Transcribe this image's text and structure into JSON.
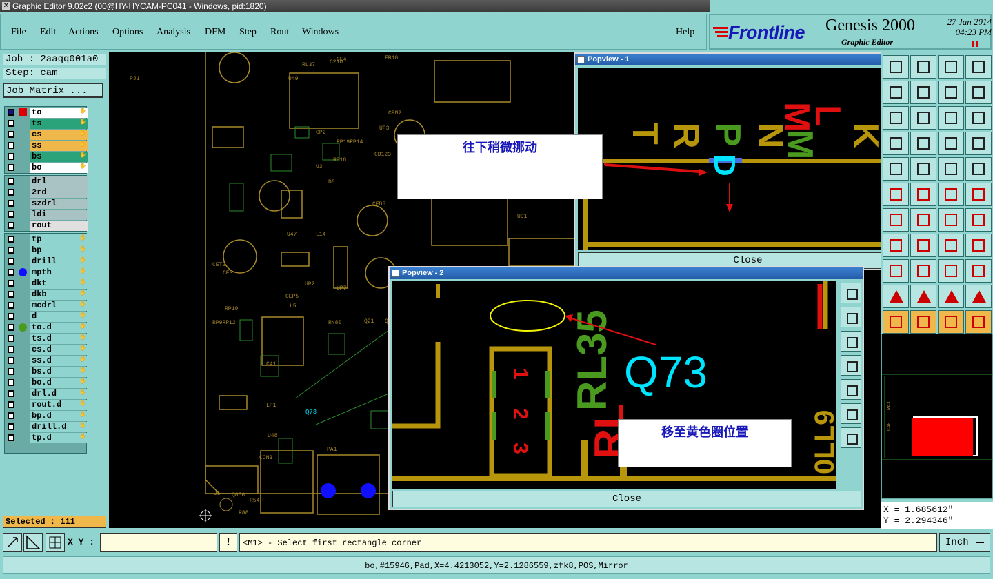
{
  "window": {
    "title": "Graphic Editor 9.02c2 (00@HY-HYCAM-PC041 - Windows, pid:1820)"
  },
  "menu": {
    "items": [
      "File",
      "Edit",
      "Actions",
      "Options",
      "Analysis",
      "DFM",
      "Step",
      "Rout",
      "Windows"
    ],
    "help": "Help"
  },
  "brand": {
    "logo": "Frontline",
    "product": "Genesis 2000",
    "subtitle": "Graphic Editor",
    "date": "27 Jan 2014",
    "time": "04:23 PM"
  },
  "job": {
    "job_label": "Job : 2aaqq001a0",
    "step_label": "Step: cam",
    "matrix_button": "Job Matrix ..."
  },
  "layers": {
    "group1": [
      {
        "name": "to",
        "color": "#ffffff"
      },
      {
        "name": "ts",
        "color": "#2aa37a"
      },
      {
        "name": "cs",
        "color": "#f0b84a"
      },
      {
        "name": "ss",
        "color": "#f0b84a"
      },
      {
        "name": "bs",
        "color": "#2aa37a"
      },
      {
        "name": "bo",
        "color": "#ffffff"
      }
    ],
    "group2": [
      {
        "name": "drl",
        "color": "#a9c2c4"
      },
      {
        "name": "2rd",
        "color": "#a9c2c4"
      },
      {
        "name": "szdrl",
        "color": "#a9c2c4"
      },
      {
        "name": "ldi",
        "color": "#a9c2c4"
      },
      {
        "name": "rout",
        "color": "#e0e0e0"
      }
    ],
    "group3": [
      {
        "name": "tp",
        "color": "#8fd4cf"
      },
      {
        "name": "bp",
        "color": "#8fd4cf"
      },
      {
        "name": "drill",
        "color": "#8fd4cf"
      },
      {
        "name": "mpth",
        "color": "#8fd4cf"
      },
      {
        "name": "dkt",
        "color": "#8fd4cf"
      },
      {
        "name": "dkb",
        "color": "#8fd4cf"
      },
      {
        "name": "mcdrl",
        "color": "#8fd4cf"
      },
      {
        "name": "d",
        "color": "#8fd4cf"
      },
      {
        "name": "to.d",
        "color": "#8fd4cf"
      },
      {
        "name": "ts.d",
        "color": "#8fd4cf"
      },
      {
        "name": "cs.d",
        "color": "#8fd4cf"
      },
      {
        "name": "ss.d",
        "color": "#8fd4cf"
      },
      {
        "name": "bs.d",
        "color": "#8fd4cf"
      },
      {
        "name": "bo.d",
        "color": "#8fd4cf"
      },
      {
        "name": "drl.d",
        "color": "#8fd4cf"
      },
      {
        "name": "rout.d",
        "color": "#8fd4cf"
      },
      {
        "name": "bp.d",
        "color": "#8fd4cf"
      },
      {
        "name": "drill.d",
        "color": "#8fd4cf"
      },
      {
        "name": "tp.d",
        "color": "#8fd4cf"
      }
    ]
  },
  "selected": "Selected : 111",
  "popview1": {
    "title": "Popview - 1",
    "close": "Close",
    "note": "往下稍微挪动",
    "glyphs": "T R P N M L K"
  },
  "popview2": {
    "title": "Popview - 2",
    "close": "Close",
    "note": "移至黄色圈位置",
    "ref_text": "Q73",
    "pin_labels": [
      "1",
      "2",
      "3"
    ],
    "side_label": "RL35"
  },
  "coords": {
    "x": "X = 1.685612\"",
    "y": "Y = 2.294346\""
  },
  "status": {
    "xy_label": "X Y :",
    "xy_value": "",
    "prompt": "<M1> - Select first rectangle corner",
    "units": "Inch"
  },
  "info": "bo,#15946,Pad,X=4.4213052,Y=2.1286559,zfk8,POS,Mirror",
  "canvas_labels": [
    "U49",
    "RL37",
    "CE4",
    "C210",
    "FB10",
    "CEN2",
    "UP3",
    "CP2",
    "RP19RP14",
    "RP18",
    "CD123",
    "U3",
    "D8",
    "CED5",
    "UD1",
    "CET2",
    "U47",
    "L14",
    "CE3",
    "UP2",
    "CEP5",
    "UP7",
    "L5",
    "RP10",
    "RP9RP12",
    "Q21",
    "Q23",
    "RN80",
    "C41",
    "LP1",
    "U48",
    "CON3",
    "PA1",
    "J5",
    "Q806",
    "R54",
    "R88",
    "PJ1",
    "Q73"
  ]
}
